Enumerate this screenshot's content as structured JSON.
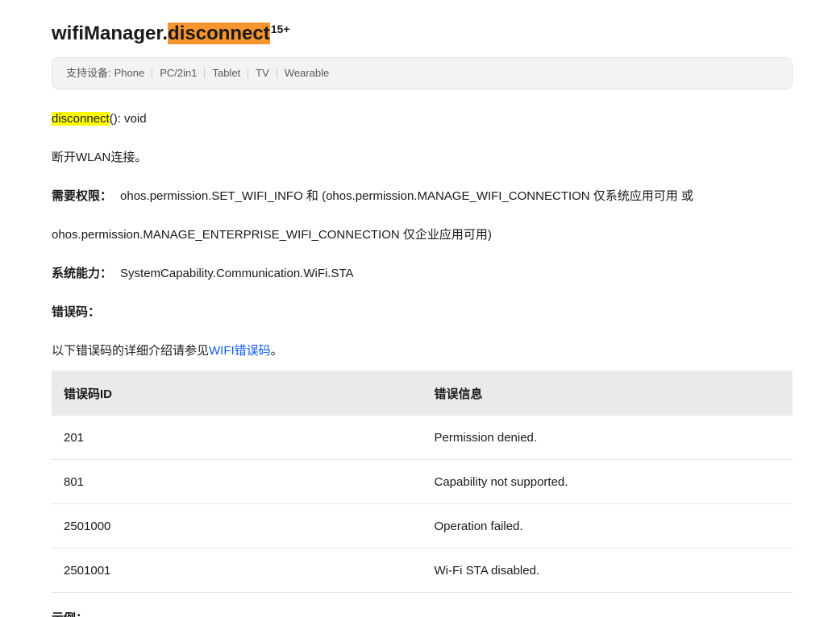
{
  "title": {
    "prefix": "wifiManager.",
    "highlight": "disconnect",
    "version": "15+"
  },
  "support": {
    "label": "支持设备:",
    "devices": [
      "Phone",
      "PC/2in1",
      "Tablet",
      "TV",
      "Wearable"
    ]
  },
  "signature": {
    "highlight": "disconnect",
    "rest": "(): void"
  },
  "description": "断开WLAN连接。",
  "permission": {
    "label": "需要权限：",
    "line1": "ohos.permission.SET_WIFI_INFO 和 (ohos.permission.MANAGE_WIFI_CONNECTION 仅系统应用可用 或",
    "line2": "ohos.permission.MANAGE_ENTERPRISE_WIFI_CONNECTION 仅企业应用可用)"
  },
  "capability": {
    "label": "系统能力：",
    "value": "SystemCapability.Communication.WiFi.STA"
  },
  "error_codes": {
    "label": "错误码：",
    "intro_prefix": "以下错误码的详细介绍请参见",
    "link_text": "WIFI错误码",
    "intro_suffix": "。",
    "table": {
      "headers": [
        "错误码ID",
        "错误信息"
      ],
      "rows": [
        [
          "201",
          "Permission denied."
        ],
        [
          "801",
          "Capability not supported."
        ],
        [
          "2501000",
          "Operation failed."
        ],
        [
          "2501001",
          "Wi-Fi STA disabled."
        ]
      ]
    }
  },
  "example_label": "示例：",
  "colors": {
    "title_highlight": "#f7952f",
    "keyword_highlight": "#ffff00",
    "link": "#0a59f7",
    "table_header_bg": "#e9eaec"
  }
}
